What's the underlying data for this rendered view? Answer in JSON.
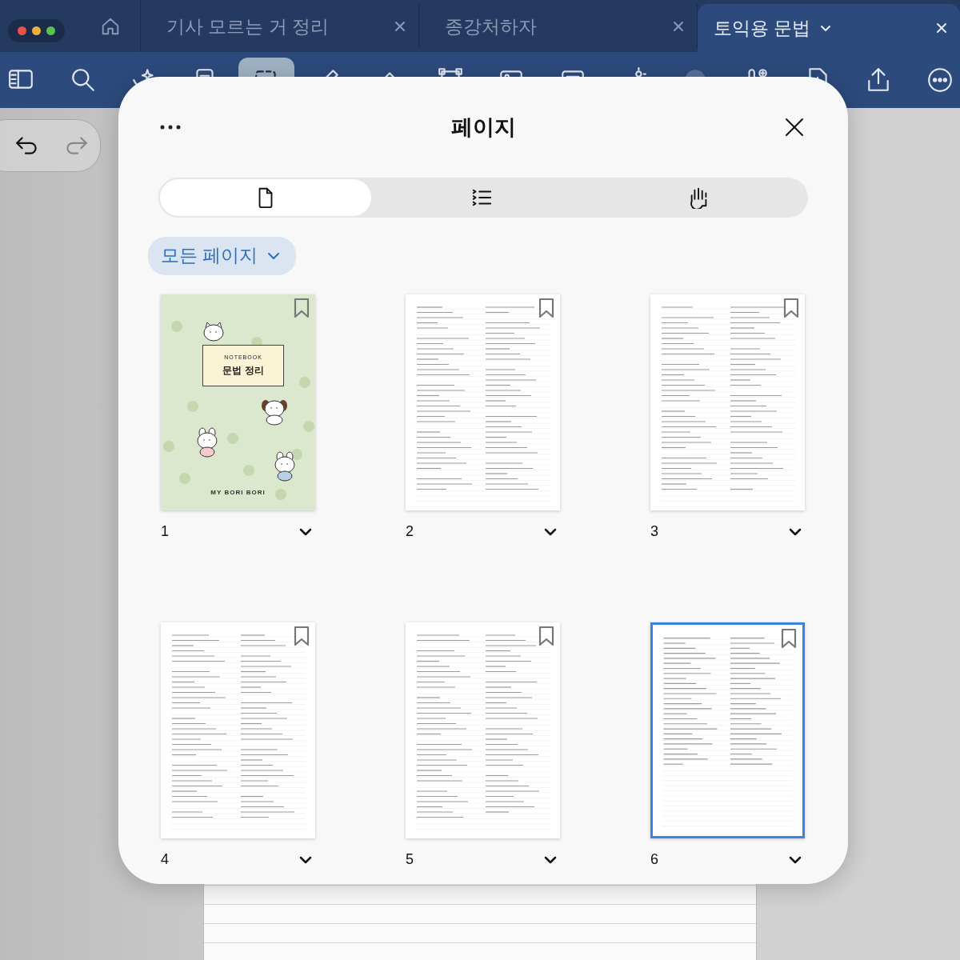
{
  "window_controls": [
    {
      "color": "#e5534b"
    },
    {
      "color": "#e9b13f"
    },
    {
      "color": "#5cc152"
    }
  ],
  "tabs": [
    {
      "title": "기사 모르는 거 정리",
      "selected": false
    },
    {
      "title": "종강처하자",
      "selected": false
    },
    {
      "title": "토익용 문법",
      "selected": true
    }
  ],
  "toolbar": [
    {
      "kind": "sidebar",
      "selected": false
    },
    {
      "kind": "search",
      "selected": false
    },
    {
      "kind": "ai",
      "selected": false
    },
    {
      "kind": "note",
      "selected": false
    },
    {
      "kind": "lasso",
      "selected": true
    },
    {
      "kind": "pen",
      "selected": false
    },
    {
      "kind": "eraser",
      "selected": false
    },
    {
      "kind": "shape",
      "selected": false
    },
    {
      "kind": "image",
      "selected": false
    },
    {
      "kind": "text",
      "selected": false
    },
    {
      "kind": "laser",
      "selected": false
    },
    {
      "kind": "circle",
      "selected": false
    },
    {
      "kind": "mic",
      "selected": false
    },
    {
      "kind": "add-page",
      "selected": false
    },
    {
      "kind": "share",
      "selected": false
    },
    {
      "kind": "more",
      "selected": false
    }
  ],
  "undo_redo": [
    {
      "kind": "undo",
      "disabled": false
    },
    {
      "kind": "redo",
      "disabled": true
    }
  ],
  "dialog": {
    "title": "페이지",
    "view_tabs": [
      {
        "kind": "pages",
        "selected": true
      },
      {
        "kind": "outline",
        "selected": false
      },
      {
        "kind": "bookmarks",
        "selected": false
      }
    ],
    "filter": "모든 페이지",
    "pages": [
      {
        "number": "1",
        "kind": "cover",
        "selected": false,
        "bookmarked": false,
        "cover": {
          "label": "NOTEBOOK",
          "title": "문법 정리",
          "brand": "MY BORI BORI"
        }
      },
      {
        "number": "2",
        "kind": "notes",
        "selected": false,
        "bookmarked": false
      },
      {
        "number": "3",
        "kind": "notes",
        "selected": false,
        "bookmarked": false
      },
      {
        "number": "4",
        "kind": "notes",
        "selected": false,
        "bookmarked": false
      },
      {
        "number": "5",
        "kind": "notes",
        "selected": false,
        "bookmarked": false
      },
      {
        "number": "6",
        "kind": "notes",
        "selected": true,
        "bookmarked": false
      }
    ]
  }
}
